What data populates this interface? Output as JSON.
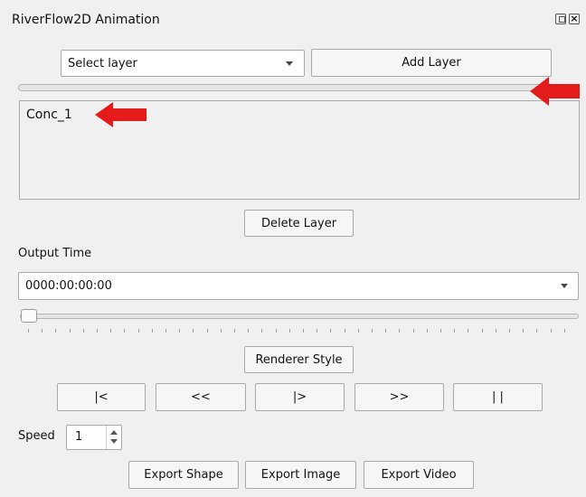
{
  "window": {
    "title": "RiverFlow2D Animation",
    "float_icon": "float-icon",
    "close_icon": "close-icon"
  },
  "layer_select": {
    "value": "Select layer"
  },
  "add_layer_label": "Add Layer",
  "layer_list": {
    "items": [
      "Conc_1"
    ]
  },
  "delete_layer_label": "Delete Layer",
  "output_time": {
    "label": "Output Time",
    "value": "0000:00:00:00",
    "slider_position": 0
  },
  "renderer_style_label": "Renderer Style",
  "playback": {
    "first_label": "|<",
    "back_label": "<<",
    "play_label": "|>",
    "forward_label": ">>",
    "pause_label": "| |"
  },
  "speed": {
    "label": "Speed",
    "value": "1"
  },
  "export": {
    "shape_label": "Export Shape",
    "image_label": "Export Image",
    "video_label": "Export Video"
  },
  "colors": {
    "annotation_arrow": "#e31b1b"
  }
}
